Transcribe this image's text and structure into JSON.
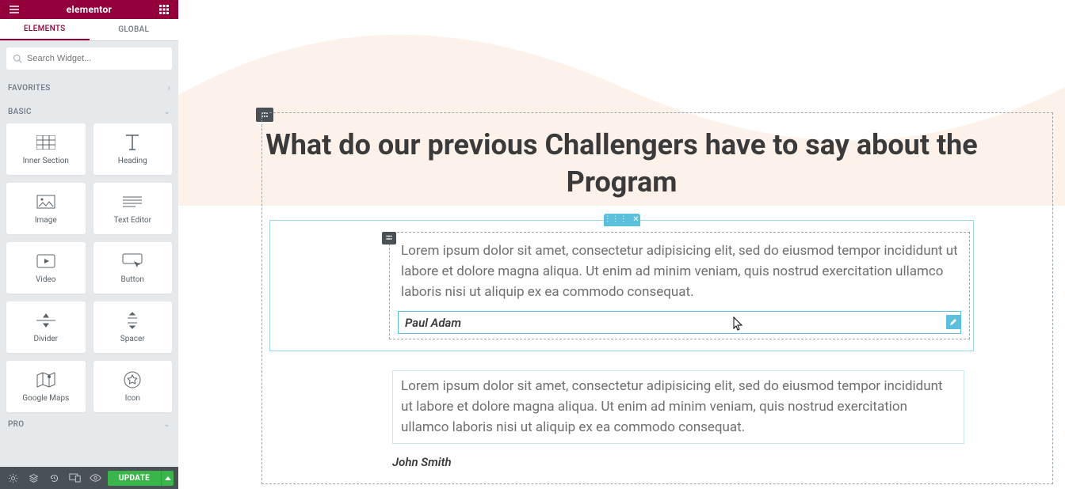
{
  "brand": "elementor",
  "tabs": {
    "elements": "ELEMENTS",
    "global": "GLOBAL"
  },
  "search": {
    "placeholder": "Search Widget..."
  },
  "categories": {
    "favorites": "FAVORITES",
    "basic": "BASIC",
    "pro": "PRO"
  },
  "widgets": {
    "inner_section": "Inner Section",
    "heading": "Heading",
    "image": "Image",
    "text_editor": "Text Editor",
    "video": "Video",
    "button": "Button",
    "divider": "Divider",
    "spacer": "Spacer",
    "google_maps": "Google Maps",
    "icon": "Icon"
  },
  "footer": {
    "update": "UPDATE"
  },
  "content": {
    "heading": "What do our previous Challengers have to say about the Program",
    "t1_text": "Lorem ipsum dolor sit amet, consectetur adipisicing elit, sed do eiusmod tempor incididunt ut labore et dolore magna aliqua. Ut enim ad minim veniam, quis nostrud exercitation ullamco laboris nisi ut aliquip ex ea commodo consequat.",
    "t1_name": "Paul Adam",
    "t2_text": "Lorem ipsum dolor sit amet, consectetur adipisicing elit, sed do eiusmod tempor incididunt ut labore et dolore magna aliqua. Ut enim ad minim veniam, quis nostrud exercitation ullamco laboris nisi ut aliquip ex ea commodo consequat.",
    "t2_name": "John Smith"
  },
  "colors": {
    "accent": "#93003c",
    "editor_blue": "#5bc0de",
    "success": "#39b54a",
    "wave": "#fdf2ea"
  }
}
